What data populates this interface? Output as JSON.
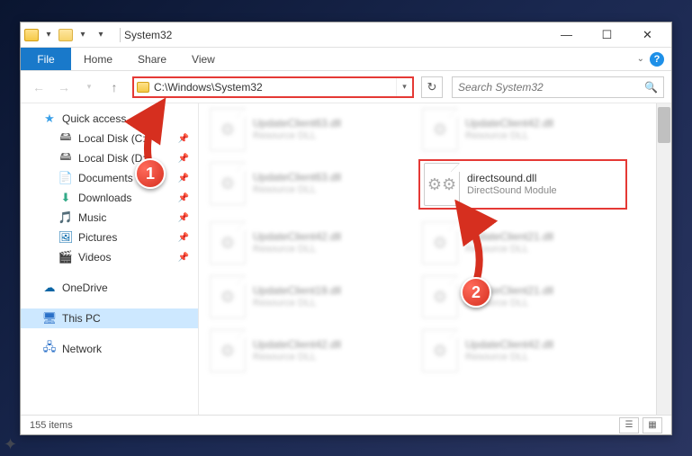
{
  "window": {
    "title": "System32"
  },
  "ribbon": {
    "file": "File",
    "tabs": [
      "Home",
      "Share",
      "View"
    ]
  },
  "nav": {
    "path": "C:\\Windows\\System32",
    "search_placeholder": "Search System32"
  },
  "sidebar": {
    "quick_access": "Quick access",
    "items": [
      {
        "label": "Local Disk (C:)",
        "icon": "drive",
        "pinned": true
      },
      {
        "label": "Local Disk (D:)",
        "icon": "drive",
        "pinned": true
      },
      {
        "label": "Documents",
        "icon": "doc",
        "pinned": true
      },
      {
        "label": "Downloads",
        "icon": "down",
        "pinned": true
      },
      {
        "label": "Music",
        "icon": "music",
        "pinned": true
      },
      {
        "label": "Pictures",
        "icon": "pic",
        "pinned": true
      },
      {
        "label": "Videos",
        "icon": "vid",
        "pinned": true
      }
    ],
    "onedrive": "OneDrive",
    "thispc": "This PC",
    "network": "Network"
  },
  "files": {
    "highlighted": {
      "name": "directsound.dll",
      "desc": "DirectSound Module"
    },
    "others": [
      {
        "name": "UpdateClient63.dll",
        "desc": "Resource DLL",
        "col": 0,
        "row": 0
      },
      {
        "name": "UpdateClient42.dll",
        "desc": "Resource DLL",
        "col": 1,
        "row": 0
      },
      {
        "name": "UpdateClient63.dll",
        "desc": "Resource DLL",
        "col": 0,
        "row": 1
      },
      {
        "name": "UpdateClient42.dll",
        "desc": "Resource DLL",
        "col": 0,
        "row": 2
      },
      {
        "name": "UpdateClient21.dll",
        "desc": "Resource DLL",
        "col": 1,
        "row": 2
      },
      {
        "name": "UpdateClient19.dll",
        "desc": "Resource DLL",
        "col": 0,
        "row": 3
      },
      {
        "name": "UpdateClient21.dll",
        "desc": "Resource DLL",
        "col": 1,
        "row": 3
      },
      {
        "name": "UpdateClient42.dll",
        "desc": "Resource DLL",
        "col": 0,
        "row": 4
      },
      {
        "name": "UpdateClient42.dll",
        "desc": "Resource DLL",
        "col": 1,
        "row": 4
      }
    ]
  },
  "status": {
    "count": "155 items"
  },
  "callouts": {
    "c1": "1",
    "c2": "2"
  }
}
